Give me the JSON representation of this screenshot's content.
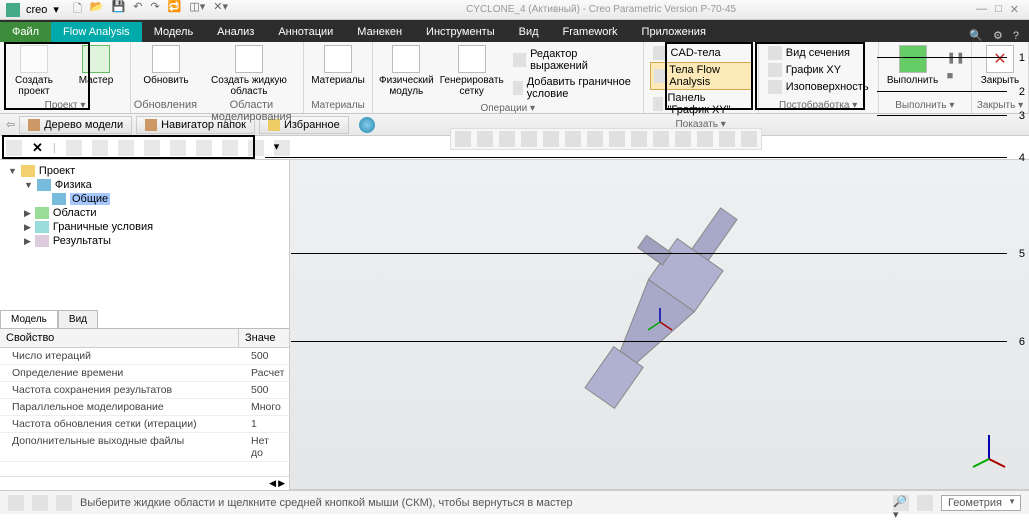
{
  "title": {
    "app": "creo",
    "doc": "CYCLONE_4 (Активный) - Creo Parametric Version P-70-45"
  },
  "tabs": [
    "Файл",
    "Flow Analysis",
    "Модель",
    "Анализ",
    "Аннотации",
    "Манекен",
    "Инструменты",
    "Вид",
    "Framework",
    "Приложения"
  ],
  "ribbon": {
    "project": {
      "create": "Создать проект",
      "wizard": "Мастер",
      "label": "Проект ▾"
    },
    "update": {
      "refresh": "Обновить",
      "fluid": "Создать жидкую область",
      "label": "Обновления",
      "label2": "Области моделирования"
    },
    "materials": {
      "btn": "Материалы",
      "label": "Материалы"
    },
    "ops": {
      "phys": "Физический модуль",
      "mesh": "Генерировать сетку",
      "rows": [
        "Редактор выражений",
        "Добавить граничное условие"
      ],
      "label": "Операции ▾"
    },
    "show": {
      "rows": [
        "CAD-тела",
        "Тела Flow Analysis",
        "Панель \"График XY\""
      ],
      "label": "Показать ▾"
    },
    "post": {
      "rows": [
        "Вид сечения",
        "График XY",
        "Изоповерхность"
      ],
      "label": "Постобработка ▾"
    },
    "run": {
      "btn": "Выполнить",
      "label": "Выполнить ▾"
    },
    "close": {
      "btn": "Закрыть",
      "label": "Закрыть ▾"
    }
  },
  "subtabs": [
    "Дерево модели",
    "Навигатор папок",
    "Избранное"
  ],
  "tree": {
    "root": "Проект",
    "nodes": [
      "Физика",
      "Общие",
      "Области",
      "Граничные условия",
      "Результаты"
    ]
  },
  "proptabs": [
    "Модель",
    "Вид"
  ],
  "prop": {
    "hdr": [
      "Свойство",
      "Значе"
    ],
    "rows": [
      [
        "Число итераций",
        "500"
      ],
      [
        "Определение времени",
        "Расчет"
      ],
      [
        "Частота сохранения результатов",
        "500"
      ],
      [
        "Параллельное моделирование",
        "Много"
      ],
      [
        "Частота обновления сетки (итерации)",
        "1"
      ],
      [
        "Дополнительные выходные файлы",
        "Нет до"
      ]
    ]
  },
  "status": {
    "hint": "Выберите жидкие области и щелкните средней кнопкой мыши (СКМ), чтобы вернуться в мастер",
    "combo": "Геометрия"
  },
  "callouts": [
    "1",
    "2",
    "3",
    "4",
    "5",
    "6"
  ]
}
